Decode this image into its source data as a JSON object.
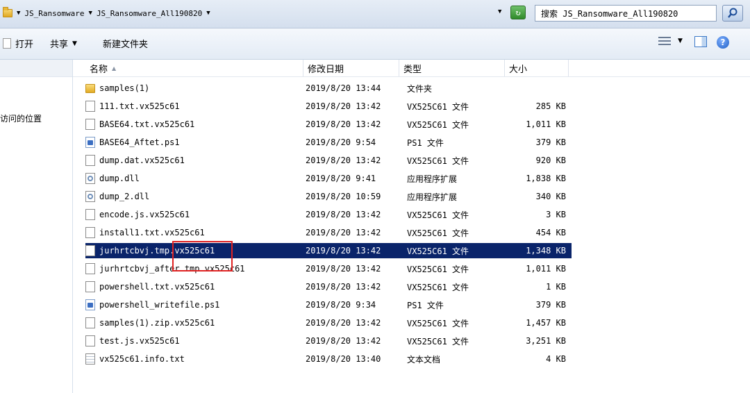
{
  "address": {
    "breadcrumb": [
      "JS_Ransomware",
      "JS_Ransomware_All190820"
    ],
    "search_text": "搜索 JS_Ransomware_All190820",
    "folder_icon": "folder-icon",
    "refresh_icon": "refresh-icon",
    "search_icon": "search-icon"
  },
  "toolbar": {
    "open_label": "打开",
    "share_label": "共享",
    "share_arrow": "▼",
    "new_folder_label": "新建文件夹",
    "view_arrow": "▼",
    "help_label": "?"
  },
  "nav": {
    "recent_places": "访问的位置"
  },
  "columns": {
    "name": "名称",
    "sort_indicator": "▲",
    "date": "修改日期",
    "type": "类型",
    "size": "大小"
  },
  "files": [
    {
      "name": "samples(1)",
      "date": "2019/8/20 13:44",
      "type": "文件夹",
      "size": "",
      "icon": "folder"
    },
    {
      "name": "111.txt.vx525c61",
      "date": "2019/8/20 13:42",
      "type": "VX525C61 文件",
      "size": "285 KB",
      "icon": "file"
    },
    {
      "name": "BASE64.txt.vx525c61",
      "date": "2019/8/20 13:42",
      "type": "VX525C61 文件",
      "size": "1,011 KB",
      "icon": "file"
    },
    {
      "name": "BASE64_Aftet.ps1",
      "date": "2019/8/20 9:54",
      "type": "PS1 文件",
      "size": "379 KB",
      "icon": "ps1"
    },
    {
      "name": "dump.dat.vx525c61",
      "date": "2019/8/20 13:42",
      "type": "VX525C61 文件",
      "size": "920 KB",
      "icon": "file"
    },
    {
      "name": "dump.dll",
      "date": "2019/8/20 9:41",
      "type": "应用程序扩展",
      "size": "1,838 KB",
      "icon": "dll"
    },
    {
      "name": "dump_2.dll",
      "date": "2019/8/20 10:59",
      "type": "应用程序扩展",
      "size": "340 KB",
      "icon": "dll"
    },
    {
      "name": "encode.js.vx525c61",
      "date": "2019/8/20 13:42",
      "type": "VX525C61 文件",
      "size": "3 KB",
      "icon": "file"
    },
    {
      "name": "install1.txt.vx525c61",
      "date": "2019/8/20 13:42",
      "type": "VX525C61 文件",
      "size": "454 KB",
      "icon": "file"
    },
    {
      "name": "jurhrtcbvj.tmp.vx525c61",
      "date": "2019/8/20 13:42",
      "type": "VX525C61 文件",
      "size": "1,348 KB",
      "icon": "file",
      "selected": true
    },
    {
      "name": "jurhrtcbvj_after.tmp.vx525c61",
      "date": "2019/8/20 13:42",
      "type": "VX525C61 文件",
      "size": "1,011 KB",
      "icon": "file"
    },
    {
      "name": "powershell.txt.vx525c61",
      "date": "2019/8/20 13:42",
      "type": "VX525C61 文件",
      "size": "1 KB",
      "icon": "file"
    },
    {
      "name": "powershell_writefile.ps1",
      "date": "2019/8/20 9:34",
      "type": "PS1 文件",
      "size": "379 KB",
      "icon": "ps1"
    },
    {
      "name": "samples(1).zip.vx525c61",
      "date": "2019/8/20 13:42",
      "type": "VX525C61 文件",
      "size": "1,457 KB",
      "icon": "file"
    },
    {
      "name": "test.js.vx525c61",
      "date": "2019/8/20 13:42",
      "type": "VX525C61 文件",
      "size": "3,251 KB",
      "icon": "file"
    },
    {
      "name": "vx525c61.info.txt",
      "date": "2019/8/20 13:40",
      "type": "文本文档",
      "size": "4 KB",
      "icon": "txt"
    }
  ],
  "colors": {
    "selection": "#0a246a",
    "highlight_box": "#e02222"
  }
}
